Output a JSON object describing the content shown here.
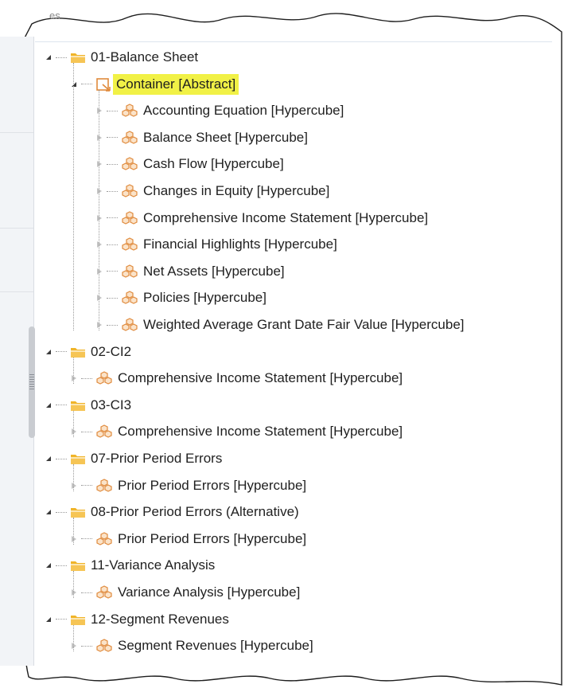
{
  "window": {
    "tab_fragment": "es"
  },
  "tree": {
    "root_items": [
      {
        "label": "01-Balance Sheet",
        "expanded": true,
        "icon": "folder-icon",
        "children": [
          {
            "label": "Container [Abstract]",
            "expanded": true,
            "selected": true,
            "icon": "abstract-container-icon",
            "children": [
              {
                "label": "Accounting Equation [Hypercube]",
                "icon": "hypercube-icon"
              },
              {
                "label": "Balance Sheet [Hypercube]",
                "icon": "hypercube-icon"
              },
              {
                "label": "Cash Flow [Hypercube]",
                "icon": "hypercube-icon"
              },
              {
                "label": "Changes in Equity [Hypercube]",
                "icon": "hypercube-icon"
              },
              {
                "label": "Comprehensive Income Statement [Hypercube]",
                "icon": "hypercube-icon"
              },
              {
                "label": "Financial Highlights [Hypercube]",
                "icon": "hypercube-icon"
              },
              {
                "label": "Net Assets [Hypercube]",
                "icon": "hypercube-icon"
              },
              {
                "label": "Policies [Hypercube]",
                "icon": "hypercube-icon"
              },
              {
                "label": "Weighted Average Grant Date Fair Value [Hypercube]",
                "icon": "hypercube-icon"
              }
            ]
          }
        ]
      },
      {
        "label": "02-CI2",
        "expanded": true,
        "icon": "folder-icon",
        "children": [
          {
            "label": "Comprehensive Income Statement [Hypercube]",
            "icon": "hypercube-icon"
          }
        ]
      },
      {
        "label": "03-CI3",
        "expanded": true,
        "icon": "folder-icon",
        "children": [
          {
            "label": "Comprehensive Income Statement [Hypercube]",
            "icon": "hypercube-icon"
          }
        ]
      },
      {
        "label": "07-Prior Period Errors",
        "expanded": true,
        "icon": "folder-icon",
        "children": [
          {
            "label": "Prior Period Errors [Hypercube]",
            "icon": "hypercube-icon"
          }
        ]
      },
      {
        "label": "08-Prior Period Errors (Alternative)",
        "expanded": true,
        "icon": "folder-icon",
        "children": [
          {
            "label": "Prior Period Errors [Hypercube]",
            "icon": "hypercube-icon"
          }
        ]
      },
      {
        "label": "11-Variance Analysis",
        "expanded": true,
        "icon": "folder-icon",
        "children": [
          {
            "label": "Variance Analysis [Hypercube]",
            "icon": "hypercube-icon"
          }
        ]
      },
      {
        "label": "12-Segment Revenues",
        "expanded": true,
        "icon": "folder-icon",
        "children": [
          {
            "label": "Segment Revenues [Hypercube]",
            "icon": "hypercube-icon"
          }
        ]
      }
    ]
  },
  "colors": {
    "folder": "#f0b429",
    "hypercube": "#e08a3c",
    "selection": "#f1f146"
  }
}
